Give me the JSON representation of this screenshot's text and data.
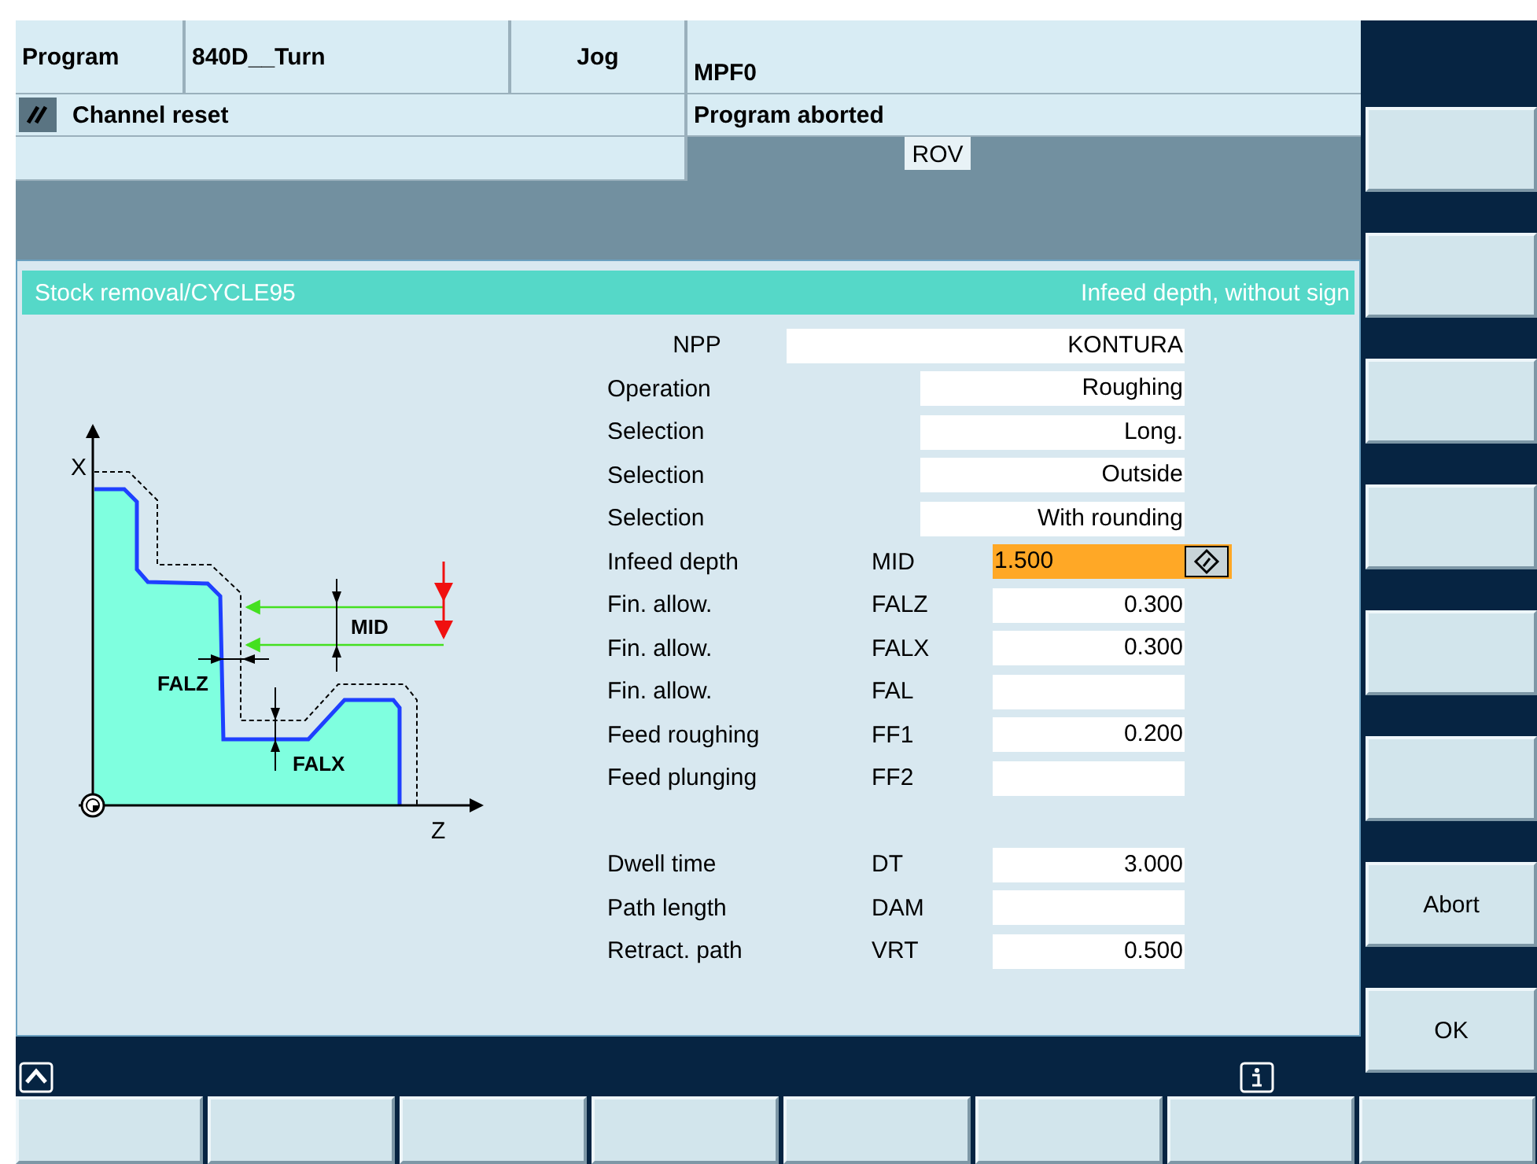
{
  "header": {
    "area": "Program",
    "machine": "840D__Turn",
    "mode": "Jog",
    "program": "MPF0",
    "channel_state": "Channel reset",
    "program_state": "Program aborted",
    "override": "ROV"
  },
  "dialog": {
    "title": "Stock removal/CYCLE95",
    "hint": "Infeed depth, without sign",
    "diagram": {
      "x_axis": "X",
      "z_axis": "Z",
      "mid_label": "MID",
      "falz_label": "FALZ",
      "falx_label": "FALX"
    },
    "fields": [
      {
        "kind": "text",
        "label": "NPP",
        "value": "KONTURA",
        "focused": false
      },
      {
        "kind": "toggle",
        "label": "Operation",
        "value": "Roughing",
        "focused": false
      },
      {
        "kind": "toggle",
        "label": "Selection",
        "value": "Long.",
        "focused": false
      },
      {
        "kind": "toggle",
        "label": "Selection",
        "value": "Outside",
        "focused": false
      },
      {
        "kind": "toggle",
        "label": "Selection",
        "value": "With rounding",
        "focused": false
      },
      {
        "kind": "number",
        "label": "Infeed depth",
        "code": "MID",
        "value": "1.500",
        "focused": true
      },
      {
        "kind": "number",
        "label": "Fin. allow.",
        "code": "FALZ",
        "value": "0.300",
        "focused": false
      },
      {
        "kind": "number",
        "label": "Fin. allow.",
        "code": "FALX",
        "value": "0.300",
        "focused": false
      },
      {
        "kind": "number",
        "label": "Fin. allow.",
        "code": "FAL",
        "focused": false
      },
      {
        "kind": "number",
        "label": "Feed roughing",
        "code": "FF1",
        "value": "0.200",
        "focused": false
      },
      {
        "kind": "number",
        "label": "Feed plunging",
        "code": "FF2",
        "focused": false
      },
      {
        "kind": "gap"
      },
      {
        "kind": "number",
        "label": "Dwell time",
        "code": "DT",
        "value": "3.000",
        "focused": false
      },
      {
        "kind": "number",
        "label": "Path length",
        "code": "DAM",
        "focused": false
      },
      {
        "kind": "number",
        "label": "Retract. path",
        "code": "VRT",
        "value": "0.500",
        "focused": false
      }
    ]
  },
  "vertical_softkeys": [
    {
      "label": "Abort"
    },
    {
      "label": "OK"
    }
  ]
}
